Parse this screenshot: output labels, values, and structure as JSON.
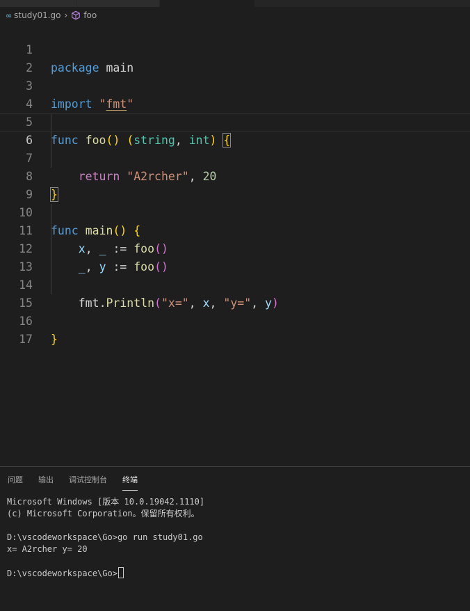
{
  "breadcrumb": {
    "file": "study01.go",
    "symbol": "foo",
    "file_icon": "go-icon",
    "symbol_icon": "cube-icon"
  },
  "editor": {
    "line_numbers": [
      "1",
      "2",
      "3",
      "4",
      "5",
      "6",
      "7",
      "8",
      "9",
      "10",
      "11",
      "12",
      "13",
      "14",
      "15",
      "16",
      "17"
    ],
    "current_line": "6",
    "code": {
      "l1": {
        "kw": "package",
        "name": "main"
      },
      "l3": {
        "kw": "import",
        "q1": "\"",
        "pkg": "fmt",
        "q2": "\""
      },
      "l5": {
        "kw": "func",
        "name": "foo",
        "p_open": "(",
        "p_close": ")",
        "r_open": "(",
        "t1": "string",
        "comma": ",",
        "t2": "int",
        "r_close": ")",
        "brace": "{"
      },
      "l7": {
        "kw": "return",
        "str": "\"A2rcher\"",
        "comma": ",",
        "num": "20"
      },
      "l8": {
        "brace": "}"
      },
      "l10": {
        "kw": "func",
        "name": "main",
        "p_open": "(",
        "p_close": ")",
        "brace": "{"
      },
      "l11": {
        "v1": "x",
        "sep": ",",
        "v2": "_",
        "op": ":=",
        "call": "foo",
        "p_open": "(",
        "p_close": ")"
      },
      "l12": {
        "v1": "_",
        "sep": ",",
        "v2": "y",
        "op": ":=",
        "call": "foo",
        "p_open": "(",
        "p_close": ")"
      },
      "l14": {
        "pkg": "fmt",
        "dot": ".",
        "call": "Println",
        "p_open": "(",
        "s1": "\"x=\"",
        "c1": ",",
        "a1": "x",
        "c2": ",",
        "s2": "\"y=\"",
        "c3": ",",
        "a2": "y",
        "p_close": ")"
      },
      "l16": {
        "brace": "}"
      }
    }
  },
  "panel": {
    "tabs": [
      "问题",
      "输出",
      "调试控制台",
      "终端"
    ],
    "active_tab": "终端",
    "terminal_lines": [
      "Microsoft Windows [版本 10.0.19042.1110]",
      "(c) Microsoft Corporation。保留所有权利。",
      "",
      "D:\\vscodeworkspace\\Go>go run study01.go",
      "x= A2rcher y= 20",
      "",
      "D:\\vscodeworkspace\\Go>"
    ]
  },
  "colors": {
    "background": "#1e1e1e",
    "keyword": "#569cd6",
    "function": "#dcdcaa",
    "string": "#ce9178",
    "number": "#b5cea8",
    "variable": "#9cdcfe",
    "type": "#4ec9b0",
    "control": "#c586c0"
  }
}
